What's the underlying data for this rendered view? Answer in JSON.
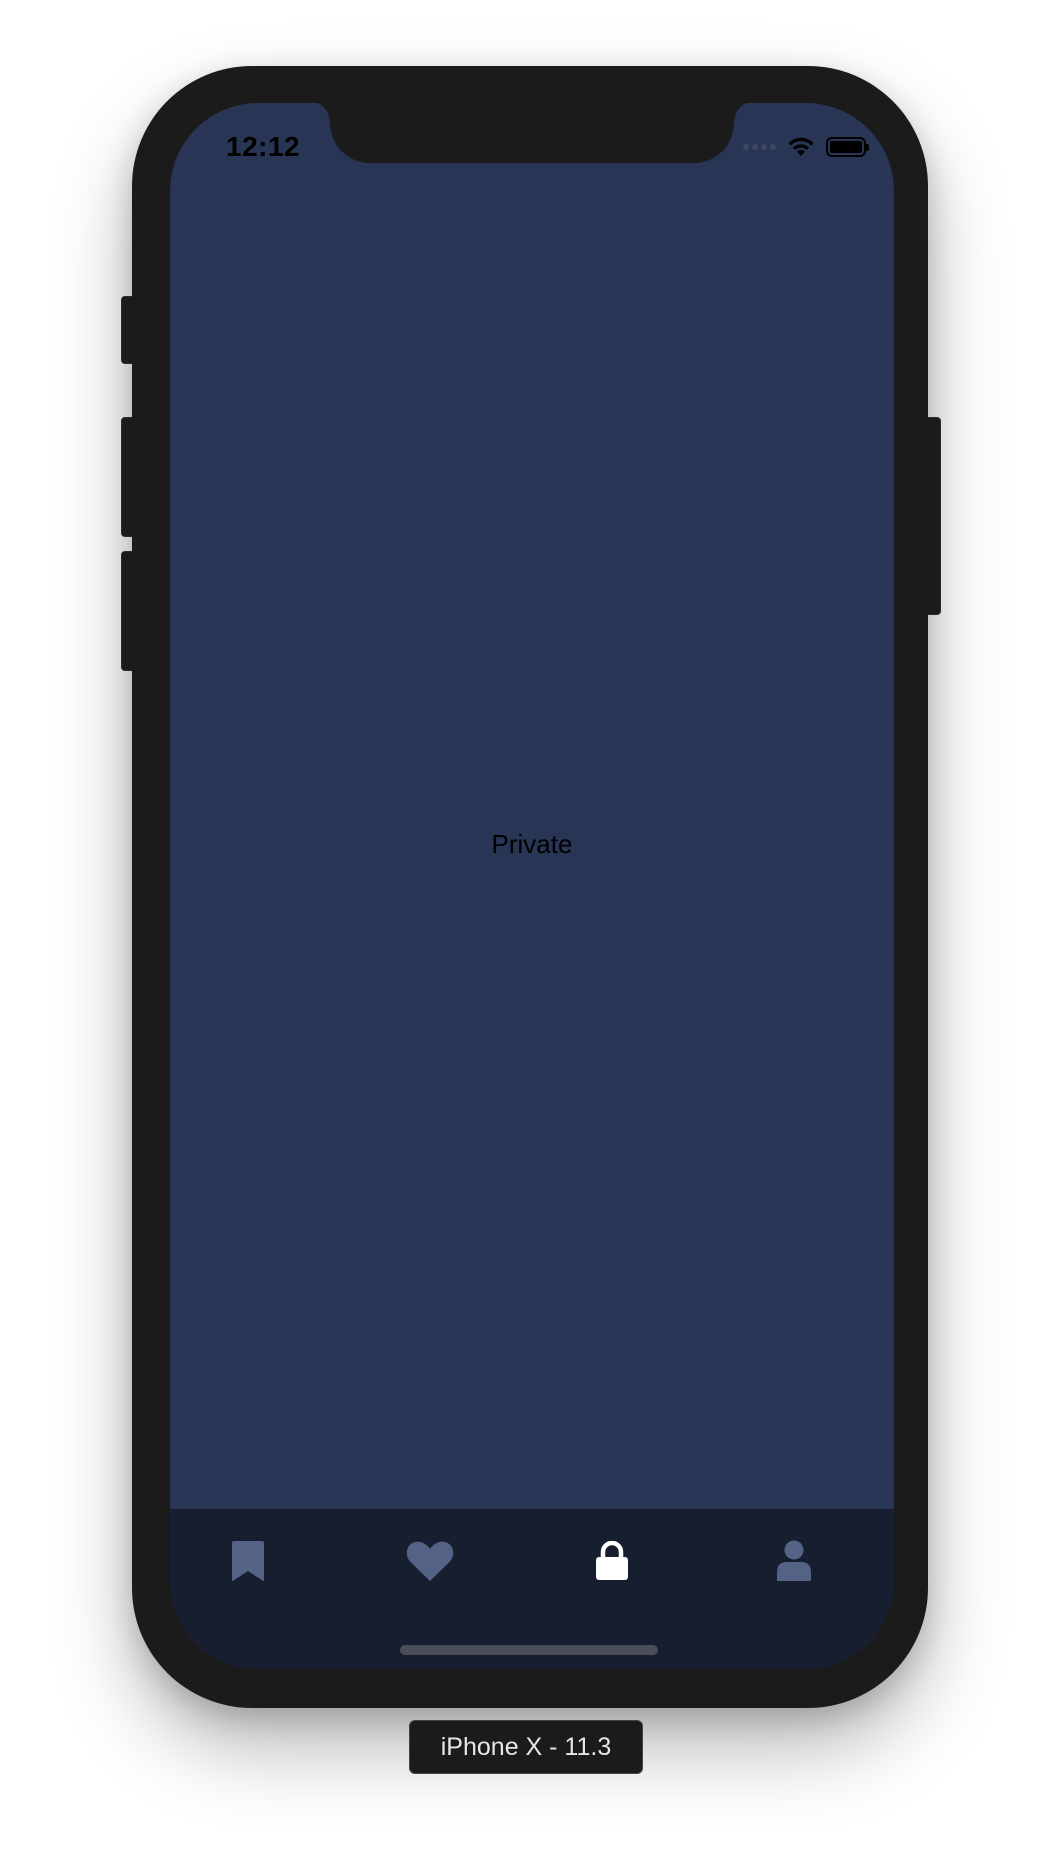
{
  "status_bar": {
    "time": "12:12"
  },
  "main": {
    "label": "Private"
  },
  "tab_bar": {
    "items": [
      {
        "name": "bookmark",
        "icon": "bookmark-icon",
        "active": false
      },
      {
        "name": "favorites",
        "icon": "heart-icon",
        "active": false
      },
      {
        "name": "private",
        "icon": "lock-icon",
        "active": true
      },
      {
        "name": "profile",
        "icon": "user-icon",
        "active": false
      }
    ]
  },
  "device": {
    "label": "iPhone X - 11.3"
  },
  "colors": {
    "screen_bg": "#283555",
    "tab_bar_bg": "#171e30",
    "tab_inactive": "#546285",
    "tab_active": "#ffffff",
    "device_frame": "#1b1b1b"
  }
}
